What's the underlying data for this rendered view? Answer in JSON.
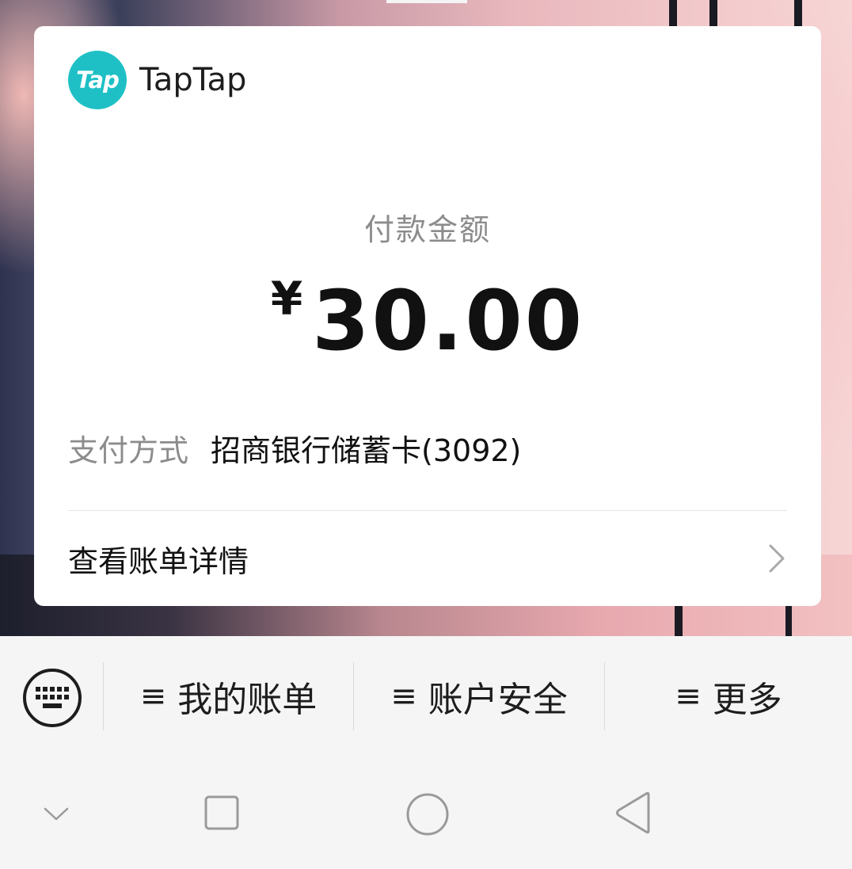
{
  "brand": {
    "logo_text": "Tap",
    "name": "TapTap",
    "logo_color": "#1ec0c6"
  },
  "payment": {
    "amount_label": "付款金额",
    "currency_symbol": "¥",
    "amount": "30.00",
    "method_label": "支付方式",
    "method_value": "招商银行储蓄卡(3092)",
    "detail_link": "查看账单详情"
  },
  "menu": {
    "keyboard_icon": "keyboard-icon",
    "items": [
      {
        "icon": "≡",
        "label": "我的账单"
      },
      {
        "icon": "≡",
        "label": "账户安全"
      },
      {
        "icon": "≡",
        "label": "更多"
      }
    ]
  },
  "navbar": {
    "buttons": [
      "chevron-down-icon",
      "recent-apps-icon",
      "home-icon",
      "back-icon"
    ]
  }
}
